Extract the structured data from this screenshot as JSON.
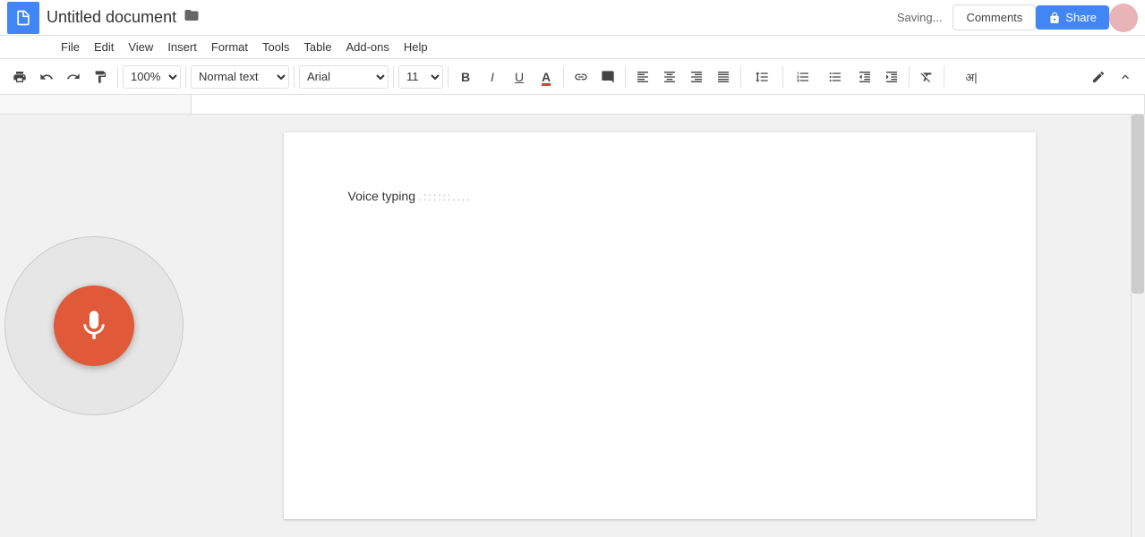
{
  "header": {
    "doc_title": "Untitled document",
    "folder_icon": "📁",
    "saving_status": "Saving...",
    "comments_label": "Comments",
    "share_label": "Share",
    "share_icon": "🔒"
  },
  "menu": {
    "items": [
      "File",
      "Edit",
      "View",
      "Insert",
      "Format",
      "Tools",
      "Table",
      "Add-ons",
      "Help"
    ]
  },
  "toolbar": {
    "zoom": "100%",
    "style": "Normal text",
    "font": "Arial",
    "size": "11",
    "bold": "B",
    "italic": "I",
    "underline": "U"
  },
  "document": {
    "voice_text": "Voice typing ",
    "voice_cursor": ".::::::...."
  },
  "voice_panel": {
    "mic_label": "microphone"
  }
}
